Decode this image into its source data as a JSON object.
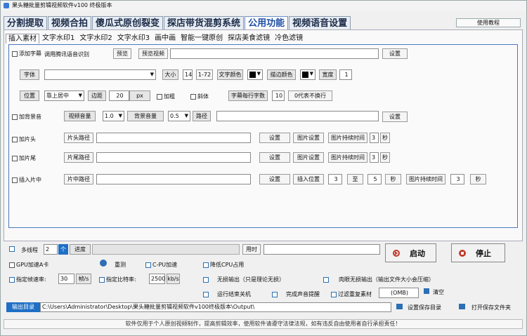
{
  "window": {
    "title": "果头糖批量剪辑视频软件v100 终极版本"
  },
  "main_tabs": [
    "分割提取",
    "视频合拍",
    "傻瓜式原创裂变",
    "探店带货混剪系统",
    "公用功能",
    "视频语音设置"
  ],
  "help_button": "使用教程",
  "sub_tabs": [
    "插入素材",
    "文字水印1",
    "文字水印2",
    "文字水印3",
    "画中画",
    "智能一键原创",
    "探店美食滤镜",
    "冷色滤镜"
  ],
  "subtitle": {
    "checkbox": "添加字幕",
    "hint": "调用腾讯语音识别",
    "preview": "预览",
    "preview_video": "预览视频",
    "settings": "设置"
  },
  "font": {
    "label": "字体",
    "size_btn": "大小",
    "size": "14",
    "range": "1-72",
    "text_color": "文字颜色",
    "stroke_color": "描边颜色",
    "width_btn": "宽度",
    "width": "1"
  },
  "position": {
    "label": "位置",
    "value": "靠上居中",
    "margin_label": "边距",
    "margin": "20",
    "unit": "px",
    "bold": "加粗",
    "italic": "斜体",
    "chars_per_line": "字幕每行字数",
    "chars": "10",
    "no_wrap": "0代表不换行"
  },
  "bgm": {
    "checkbox": "加背景音",
    "video_vol": "视频音量",
    "video_vol_val": "1.0",
    "bg_vol": "背景音量",
    "bg_vol_val": "0.5",
    "path": "路径",
    "settings": "设置"
  },
  "head": {
    "checkbox": "加片头",
    "path": "片头路径",
    "settings": "设置",
    "img_settings": "图片设置",
    "img_duration": "图片持续时间",
    "duration": "3",
    "sec": "秒"
  },
  "tail": {
    "checkbox": "加片尾",
    "path": "片尾路径",
    "settings": "设置",
    "img_settings": "图片设置",
    "img_duration": "图片持续时间",
    "duration": "3",
    "sec": "秒"
  },
  "middle": {
    "checkbox": "插入片中",
    "path": "片中路径",
    "settings": "设置",
    "insert_pos": "插入位置",
    "from": "3",
    "to_label": "至",
    "to": "5",
    "sec": "秒",
    "img_duration": "图片持续时间",
    "duration": "3",
    "sec2": "秒"
  },
  "bottom": {
    "multithread": "多线程",
    "threads": "2",
    "unit": "个",
    "progress_label": "进度",
    "elapsed": "用时",
    "gpu": "GPU加速A卡",
    "retest": "重测",
    "cpu": "C-PU加速",
    "lower_cpu": "降低CPU占用",
    "set_fps": "指定帧速率:",
    "fps": "30",
    "fps_unit": "帧/s",
    "set_bitrate": "指定比特率:",
    "bitrate": "2500",
    "bitrate_unit": "kb/s",
    "lossless": "无损输出（只是理论无损）",
    "visual_lossless": "肉眼无损输出（输出文件大小会压缩）",
    "shutdown": "运行结束关机",
    "sound": "完成声音提醒",
    "filter_dup": "过滤重复素材",
    "size": "(OMB)",
    "clear": "清空",
    "start": "启动",
    "stop": "停止",
    "out_label": "输出目录",
    "out_path": "C:\\Users\\Administrator\\Desktop\\果头糖批量剪辑视频软件v100终极版本\\Output\\",
    "set_dir": "设置保存目录",
    "open_dir": "打开保存文件夹"
  },
  "footer": "软件仅用于个人原创视频制作，提高剪辑效率，使用软件请遵守法律法规，如有违反自由使用者自行承担责任！",
  "colors": {
    "accent": "#1f6fc6",
    "start": "#c0392b",
    "stop": "#c0392b"
  }
}
